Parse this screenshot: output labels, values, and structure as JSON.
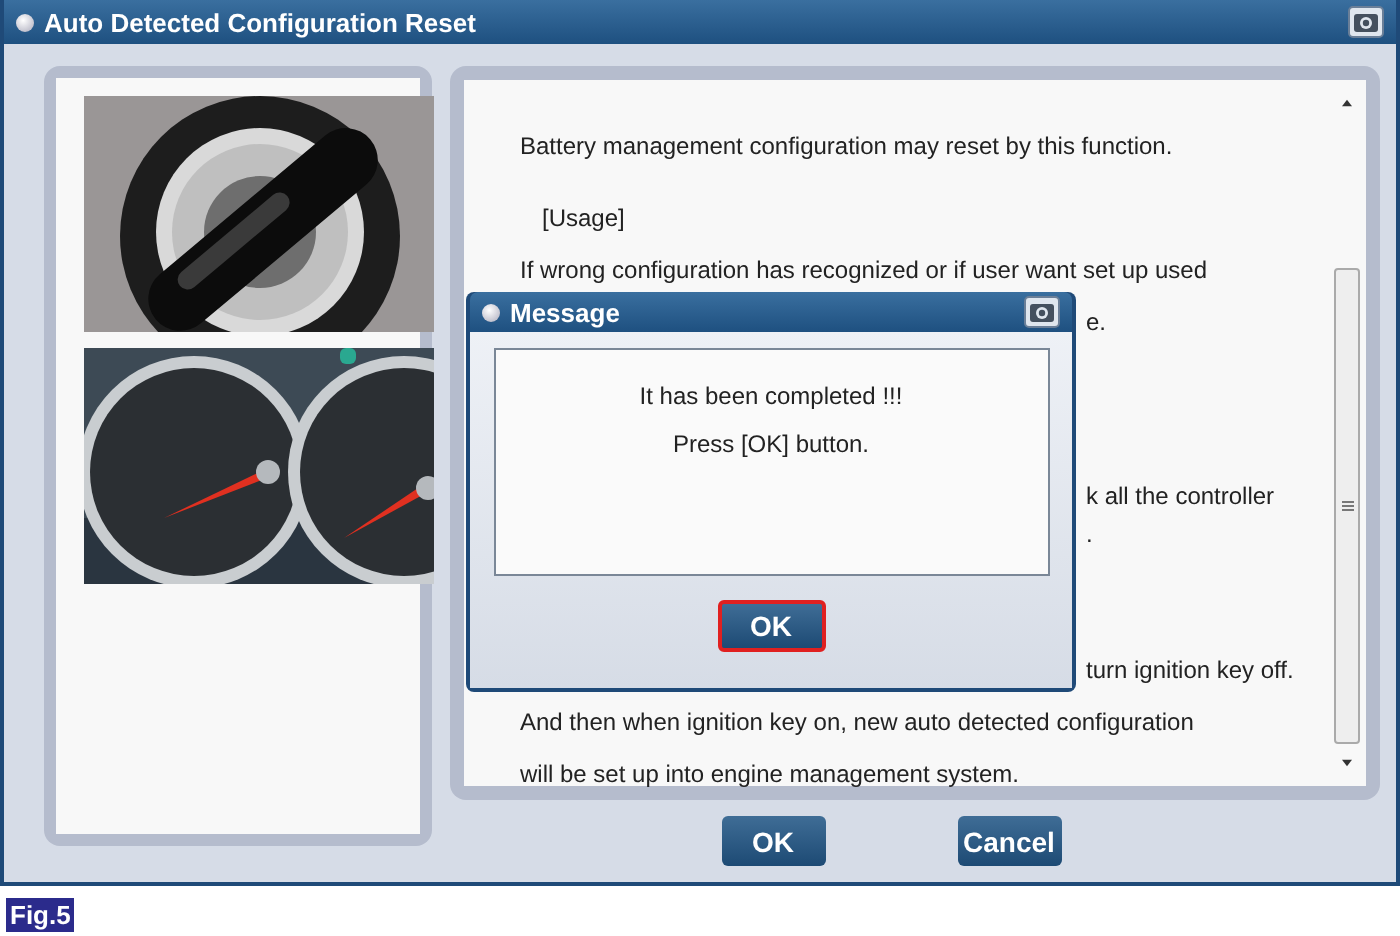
{
  "window": {
    "title": "Auto Detected Configuration Reset"
  },
  "content": {
    "lines": [
      {
        "text": "Battery management configuration may reset by this function.",
        "kind": "full"
      },
      {
        "text": "[Usage]",
        "kind": "heading"
      },
      {
        "text": "If wrong configuration has recognized or if user want set up used",
        "kind": "full"
      },
      {
        "text": "e.",
        "kind": "partial"
      },
      {
        "text": "k all the controller",
        "kind": "partial"
      },
      {
        "text": ".",
        "kind": "partial"
      },
      {
        "text": "turn ignition key off.",
        "kind": "partial"
      },
      {
        "text": "And then when ignition key on, new auto detected configuration",
        "kind": "full"
      },
      {
        "text": "will be set up into engine management system.",
        "kind": "full"
      }
    ]
  },
  "buttons": [
    {
      "label": "OK"
    },
    {
      "label": "Cancel"
    }
  ],
  "dialog": {
    "title": "Message",
    "lines": [
      "It has been completed !!!",
      "Press [OK] button."
    ],
    "button": {
      "label": "OK",
      "focused": true
    }
  },
  "figure_label": "Fig.5"
}
